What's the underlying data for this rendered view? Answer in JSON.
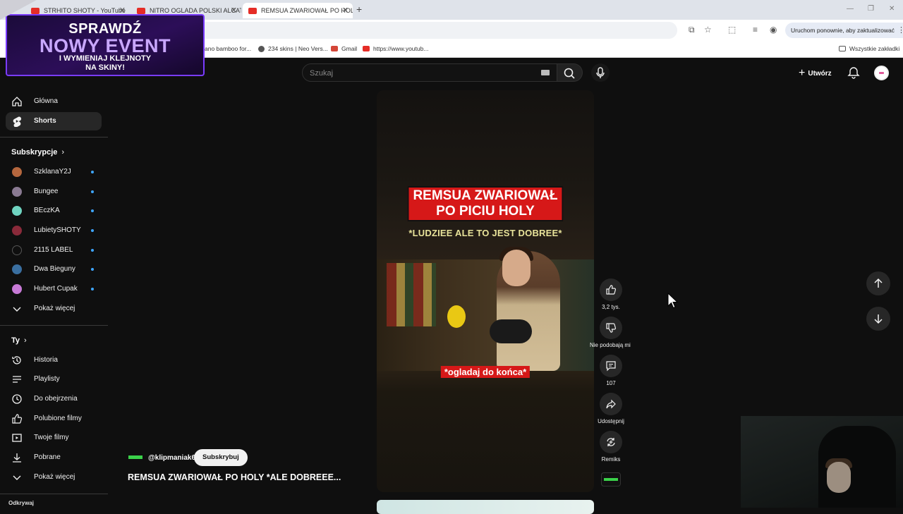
{
  "browser": {
    "tabs": [
      {
        "title": "STRHITO SHOTY - YouTube",
        "active": false
      },
      {
        "title": "NITRO OGLADA POLSKI ALCATRAZ",
        "active": false
      },
      {
        "title": "REMSUA ZWARIOWAŁ PO HOLY",
        "active": true
      }
    ],
    "update_button": "Uruchom ponownie, aby zaktualizować",
    "bookmarks": [
      {
        "label": "ano bamboo for..."
      },
      {
        "label": "234 skins | Neo Vers..."
      },
      {
        "label": "Gmail"
      },
      {
        "label": "https://www.youtub..."
      }
    ],
    "all_bookmarks": "Wszystkie zakładki"
  },
  "event_banner": {
    "line1": "SPRAWDŹ",
    "line2": "NOWY EVENT",
    "line3": "I WYMIENIAJ KLEJNOTY",
    "line4": "NA SKINY!"
  },
  "header": {
    "search_placeholder": "Szukaj",
    "create_label": "Utwórz"
  },
  "sidebar": {
    "nav": [
      {
        "label": "Główna",
        "icon": "home-icon"
      },
      {
        "label": "Shorts",
        "icon": "shorts-icon",
        "active": true
      }
    ],
    "subs_heading": "Subskrypcje",
    "subscriptions": [
      {
        "label": "SzklanaY2J",
        "color": "#b5673e"
      },
      {
        "label": "Bungee",
        "color": "#8a7a92"
      },
      {
        "label": "BEczKA",
        "color": "#6fd3c0"
      },
      {
        "label": "LubietySHOTY",
        "color": "#8a2a3a"
      },
      {
        "label": "2115 LABEL",
        "color": "#0f0f0f"
      },
      {
        "label": "Dwa Bieguny",
        "color": "#3a6fa0"
      },
      {
        "label": "Hubert Cupak",
        "color": "#c77ad6"
      }
    ],
    "subs_more": "Pokaż więcej",
    "you_heading": "Ty",
    "you_items": [
      {
        "label": "Historia",
        "icon": "history-icon"
      },
      {
        "label": "Playlisty",
        "icon": "playlist-icon"
      },
      {
        "label": "Do obejrzenia",
        "icon": "clock-icon"
      },
      {
        "label": "Polubione filmy",
        "icon": "thumb-up-icon"
      },
      {
        "label": "Twoje filmy",
        "icon": "video-icon"
      },
      {
        "label": "Pobrane",
        "icon": "download-icon"
      }
    ],
    "you_more": "Pokaż więcej",
    "footer_label": "Odkrywaj"
  },
  "short": {
    "caption_line1": "REMSUA ZWARIOWAŁ",
    "caption_line2": "PO PICIU HOLY",
    "caption_sub": "*LUDZIEE ALE TO JEST DOBREE*",
    "caption_bottom": "*ogladaj do końca*",
    "channel": "@klipmaniak6",
    "subscribe": "Subskrybuj",
    "title": "REMSUA ZWARIOWAŁ PO HOLY *ALE DOBREEE..."
  },
  "actions": {
    "like_count": "3,2 tys.",
    "dislike_label": "Nie podobają mi się",
    "comments_count": "107",
    "share_label": "Udostępnij",
    "remix_label": "Remiks"
  }
}
